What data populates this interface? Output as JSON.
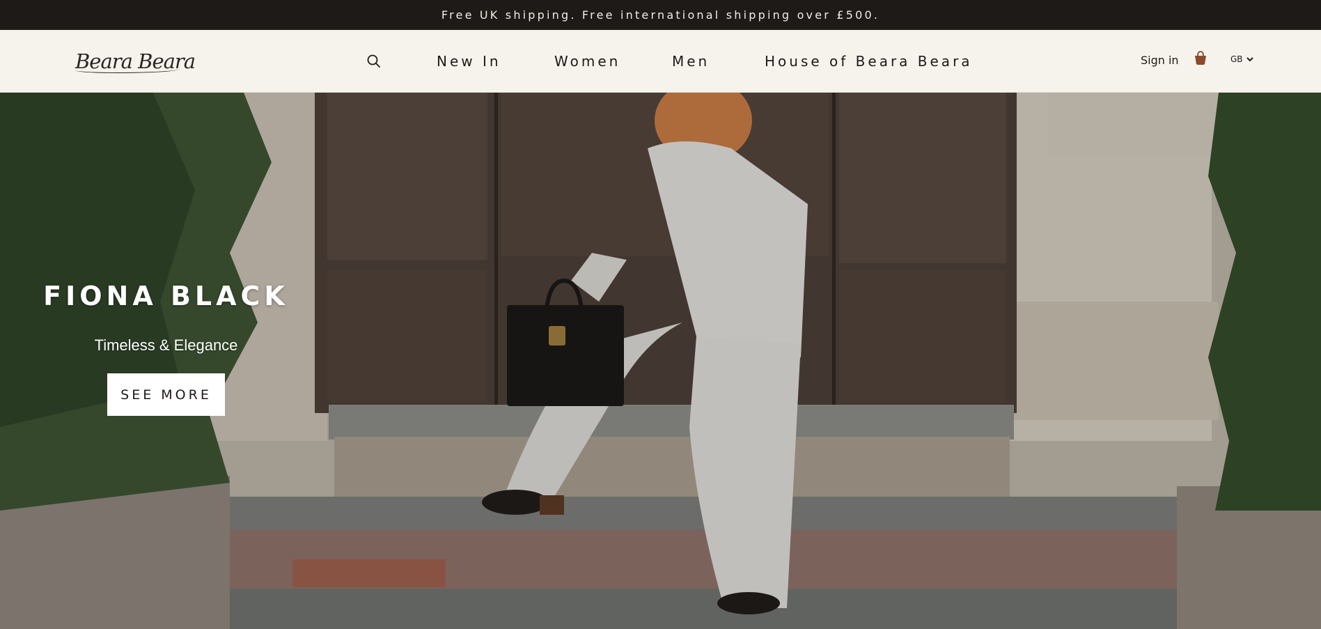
{
  "announcement": "Free UK shipping. Free international shipping over £500.",
  "brand": {
    "logo_text": "Beara Beara"
  },
  "nav": {
    "search_icon": "search-icon",
    "items": [
      {
        "label": "New In"
      },
      {
        "label": "Women"
      },
      {
        "label": "Men"
      },
      {
        "label": "House of Beara Beara"
      }
    ]
  },
  "account": {
    "sign_in_label": "Sign in",
    "bag_icon": "shopping-bag-icon"
  },
  "locale": {
    "country_code": "GB",
    "icon": "chevron-down-icon"
  },
  "hero": {
    "title": "FIONA BLACK",
    "subtitle": "Timeless & Elegance",
    "cta_label": "SEE MORE"
  },
  "colors": {
    "announcement_bg": "#1e1a18",
    "header_bg": "#f5f3ec",
    "text_dark": "#1e1a18",
    "bag_accent": "#8a4a2c",
    "cta_bg": "#ffffff"
  }
}
